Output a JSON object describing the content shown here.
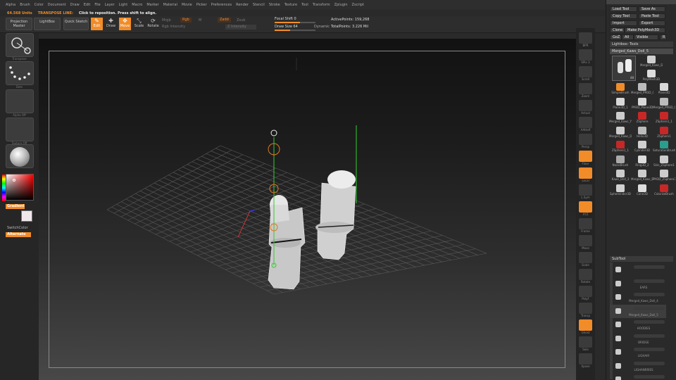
{
  "menu": [
    "Alpha",
    "Brush",
    "Color",
    "Document",
    "Draw",
    "Edit",
    "File",
    "Layer",
    "Light",
    "Macro",
    "Marker",
    "Material",
    "Movie",
    "Picker",
    "Preferences",
    "Render",
    "Stencil",
    "Stroke",
    "Texture",
    "Tool",
    "Transform",
    "Zplugin",
    "Zscript"
  ],
  "status": {
    "mem": "64.568 Units",
    "mode": "TRANSPOSE LINE:",
    "hint": "Click to reposition. Press shift to align."
  },
  "toolbar": {
    "projection_master": "Projection Master",
    "lightbox": "LightBox",
    "quick_sketch": "Quick Sketch",
    "edit": "Edit",
    "draw": "Draw",
    "move": "Move",
    "scale": "Scale",
    "rotate": "Rotate",
    "mrgb": "Mrgb",
    "rgb": "Rgb",
    "m": "M",
    "zadd": "Zadd",
    "zsub": "Zsub",
    "rgb_intensity": "Rgb Intensity",
    "z_intensity": "Z Intensity",
    "focal_shift": "Focal Shift 0",
    "draw_size": "Draw Size 64",
    "dynamic": "Dynamic",
    "active_points": "ActivePoints: 159,268",
    "total_points": "TotalPoints: 3.226 Mil"
  },
  "left": {
    "slots": [
      "Transpose",
      "Dots",
      "Alpha Off",
      "Texture Off",
      ""
    ],
    "gradient": "Gradient",
    "switch_color": "SwitchColor",
    "alternate": "Alternate"
  },
  "rightcol": [
    {
      "label": "BPR",
      "orange": false
    },
    {
      "label": "SPix 3",
      "orange": false
    },
    {
      "label": "Scroll",
      "orange": false
    },
    {
      "label": "Zoom",
      "orange": false
    },
    {
      "label": "Actual",
      "orange": false
    },
    {
      "label": "AAHalf",
      "orange": false
    },
    {
      "label": "Persp",
      "orange": false
    },
    {
      "label": "Floor",
      "orange": true
    },
    {
      "label": "Local",
      "orange": true
    },
    {
      "label": "L.Sym",
      "orange": false
    },
    {
      "label": "XYZ",
      "orange": true
    },
    {
      "label": "Frame",
      "orange": false
    },
    {
      "label": "Move",
      "orange": false
    },
    {
      "label": "Scale",
      "orange": false
    },
    {
      "label": "Rotate",
      "orange": false
    },
    {
      "label": "PolyF",
      "orange": false
    },
    {
      "label": "Transp",
      "orange": false
    },
    {
      "label": "Ghost",
      "orange": true
    },
    {
      "label": "Solo",
      "orange": false
    },
    {
      "label": "Xpose",
      "orange": false
    }
  ],
  "rightpanel": {
    "load_tool": "Load Tool",
    "save_as": "Save As",
    "copy_tool": "Copy Tool",
    "paste_tool": "Paste Tool",
    "import": "Import",
    "export": "Export",
    "clone": "Clone",
    "make_polymesh": "Make PolyMesh3D",
    "goz": "GoZ",
    "all": "All",
    "visible": "Visible",
    "r": "R",
    "lightbox_tools": "Lightbox› Tools",
    "current_tool": "Merged_Kaws_Doll_5",
    "current_tool_count": "48",
    "tools": [
      {
        "label": "Merged_Kaws_Doll",
        "color": "#cfcfcf"
      },
      {
        "label": "PolyMesh3D",
        "color": "#dcdcdc"
      },
      {
        "label": "SimpleBrush",
        "color": "#f28c28"
      },
      {
        "label": "Merged_PM3D_C",
        "color": "#bbbbbb"
      },
      {
        "label": "Plane3D",
        "color": "#d8d8d8"
      },
      {
        "label": "Plane3D_1",
        "color": "#d8d8d8"
      },
      {
        "label": "PM3D_Plane3D",
        "color": "#d8d8d8"
      },
      {
        "label": "Merged_PM3D_C",
        "color": "#bbbbbb"
      },
      {
        "label": "Merged_Kaws_Y",
        "color": "#cccccc"
      },
      {
        "label": "ZSphere",
        "color": "#c62828"
      },
      {
        "label": "ZSphere1_1",
        "color": "#c62828"
      },
      {
        "label": "Merged_Kaws_Do",
        "color": "#cccccc"
      },
      {
        "label": "Helix3D",
        "color": "#bbbbbb"
      },
      {
        "label": "ZSphere1",
        "color": "#c62828"
      },
      {
        "label": "ZSphere1_1",
        "color": "#c62828"
      },
      {
        "label": "Cylinder3D",
        "color": "#d0d0d0"
      },
      {
        "label": "SaturationBrush",
        "color": "#2a9d8f"
      },
      {
        "label": "NoiseBrush",
        "color": "#aaaaaa"
      },
      {
        "label": "Ring3D_2",
        "color": "#dddddd"
      },
      {
        "label": "Skin_ZSphere1",
        "color": "#cccccc"
      },
      {
        "label": "Kaws_Doll_3",
        "color": "#cccccc"
      },
      {
        "label": "Merged_Kaws_D",
        "color": "#cccccc"
      },
      {
        "label": "PM3D_ZSphere3",
        "color": "#cccccc"
      },
      {
        "label": "Sphereinder3D",
        "color": "#d0d0d0"
      },
      {
        "label": "Cone3D",
        "color": "#dddddd"
      },
      {
        "label": "ColorizeBrush",
        "color": "#c62828"
      }
    ],
    "subtool_header": "SubTool",
    "subtools": [
      "",
      "EARS",
      "Merged_Kaws_Doll_4",
      "Merged_Kaws_Doll_5",
      "HOODIES",
      "BRIDGE",
      "LIGHAIR",
      "LIGHANRRIES",
      "SCHOENER"
    ]
  }
}
